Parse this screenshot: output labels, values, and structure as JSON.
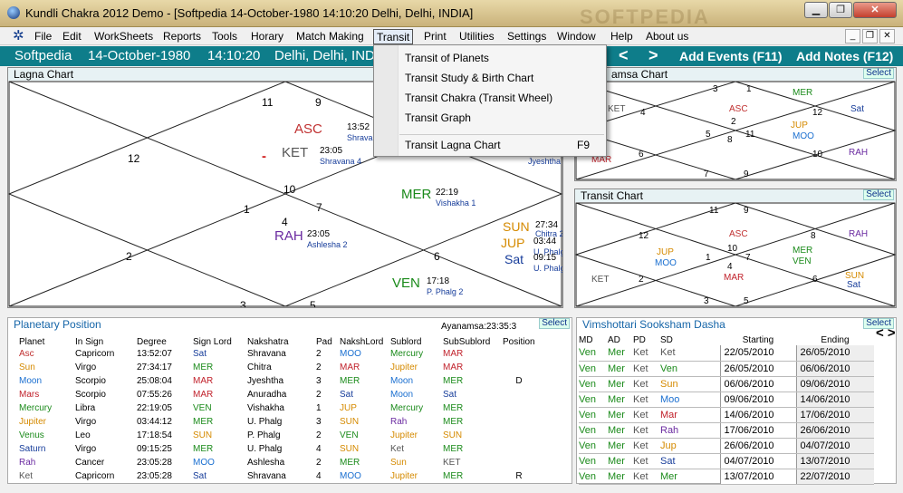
{
  "window": {
    "title": "Kundli Chakra 2012 Demo - [Softpedia     14-October-1980     14:10:20     Delhi, Delhi, INDIA]",
    "controls": [
      "▁",
      "❐",
      "✕"
    ],
    "watermark": "SOFTPEDIA"
  },
  "menu": {
    "items": [
      "File",
      "Edit",
      "WorkSheets",
      "Reports",
      "Tools",
      "Horary",
      "Match Making",
      "Transit",
      "Print",
      "Utilities",
      "Settings",
      "Window",
      "Help",
      "About us"
    ],
    "mdi_controls": [
      "_",
      "❐",
      "✕"
    ]
  },
  "info": {
    "name": "Softpedia",
    "date": "14-October-1980",
    "time": "14:10:20",
    "place": "Delhi, Delhi, INDIA",
    "prev": "<",
    "next": ">",
    "add_events": "Add Events (F11)",
    "add_notes": "Add Notes (F12)"
  },
  "dropdown": {
    "items": [
      "Transit of Planets",
      "Transit Study & Birth Chart",
      "Transit Chakra (Transit Wheel)",
      "Transit Graph",
      "Transit Lagna Chart"
    ],
    "shortcut": "F9"
  },
  "lagna": {
    "title": "Lagna Chart",
    "houses": [
      "11",
      "9",
      "12",
      "10",
      "1",
      "7",
      "4",
      "2",
      "6",
      "3",
      "5"
    ],
    "planets": [
      {
        "name": "ASC",
        "deg": "13:52",
        "nak": "Shrava"
      },
      {
        "name": "KET",
        "deg": "23:05",
        "nak": "Shravana 4"
      },
      {
        "name": "MER",
        "deg": "22:19",
        "nak": "Vishakha 1"
      },
      {
        "name": "RAH",
        "deg": "23:05",
        "nak": "Ashlesha 2"
      },
      {
        "name": "SUN",
        "deg": "27:34",
        "nak": "Chitra 2"
      },
      {
        "name": "JUP",
        "deg": "03:44",
        "nak": "U. Phalg"
      },
      {
        "name": "Sat",
        "deg": "09:15",
        "nak": "U. Phalg"
      },
      {
        "name": "VEN",
        "deg": "17:18",
        "nak": "P. Phalg 2"
      }
    ],
    "moon_nak": "Jyeshtha",
    "retro_mark": "-"
  },
  "navamsa": {
    "title": "amsa Chart",
    "select": "Select",
    "houses": [
      "3",
      "1",
      "4",
      "12",
      "5",
      "11",
      "2",
      "8",
      "6",
      "10",
      "7",
      "9"
    ],
    "planets": [
      "MER",
      "KET",
      "ASC",
      "Sat",
      "JUP",
      "MOO",
      "MAR",
      "RAH"
    ]
  },
  "transit": {
    "title": "Transit Chart",
    "select": "Select",
    "houses": [
      "11",
      "9",
      "12",
      "8",
      "10",
      "1",
      "7",
      "4",
      "2",
      "6",
      "3",
      "5"
    ],
    "planets": [
      "ASC",
      "RAH",
      "JUP",
      "MOO",
      "MER",
      "VEN",
      "MAR",
      "KET",
      "SUN",
      "Sat"
    ]
  },
  "planetary": {
    "title": "Planetary Position",
    "ayanamsa": "Ayanamsa:23:35:3",
    "select": "Select",
    "headers": [
      "Planet",
      "In Sign",
      "Degree",
      "Sign Lord",
      "Nakshatra",
      "Pad",
      "NakshLord",
      "Sublord",
      "SubSublord",
      "Position"
    ],
    "rows": [
      [
        "Asc",
        "Capricorn",
        "13:52:07",
        "Sat",
        "Shravana",
        "2",
        "MOO",
        "Mercury",
        "MAR",
        ""
      ],
      [
        "Sun",
        "Virgo",
        "27:34:17",
        "MER",
        "Chitra",
        "2",
        "MAR",
        "Jupiter",
        "MAR",
        ""
      ],
      [
        "Moon",
        "Scorpio",
        "25:08:04",
        "MAR",
        "Jyeshtha",
        "3",
        "MER",
        "Moon",
        "MER",
        "D"
      ],
      [
        "Mars",
        "Scorpio",
        "07:55:26",
        "MAR",
        "Anuradha",
        "2",
        "Sat",
        "Moon",
        "Sat",
        ""
      ],
      [
        "Mercury",
        "Libra",
        "22:19:05",
        "VEN",
        "Vishakha",
        "1",
        "JUP",
        "Mercury",
        "MER",
        ""
      ],
      [
        "Jupiter",
        "Virgo",
        "03:44:12",
        "MER",
        "U. Phalg",
        "3",
        "SUN",
        "Rah",
        "MER",
        ""
      ],
      [
        "Venus",
        "Leo",
        "17:18:54",
        "SUN",
        "P. Phalg",
        "2",
        "VEN",
        "Jupiter",
        "SUN",
        ""
      ],
      [
        "Saturn",
        "Virgo",
        "09:15:25",
        "MER",
        "U. Phalg",
        "4",
        "SUN",
        "Ket",
        "MER",
        ""
      ],
      [
        "Rah",
        "Cancer",
        "23:05:28",
        "MOO",
        "Ashlesha",
        "2",
        "MER",
        "Sun",
        "KET",
        ""
      ],
      [
        "Ket",
        "Capricorn",
        "23:05:28",
        "Sat",
        "Shravana",
        "4",
        "MOO",
        "Jupiter",
        "MER",
        "R"
      ]
    ]
  },
  "dasha": {
    "title": "Vimshottari Sooksham Dasha",
    "select": "Select",
    "headers": [
      "MD",
      "AD",
      "PD",
      "SD",
      "Starting",
      "Ending"
    ],
    "nav": "< >",
    "rows": [
      [
        "Ven",
        "Mer",
        "Ket",
        "Ket",
        "22/05/2010",
        "26/05/2010"
      ],
      [
        "Ven",
        "Mer",
        "Ket",
        "Ven",
        "26/05/2010",
        "06/06/2010"
      ],
      [
        "Ven",
        "Mer",
        "Ket",
        "Sun",
        "06/06/2010",
        "09/06/2010"
      ],
      [
        "Ven",
        "Mer",
        "Ket",
        "Moo",
        "09/06/2010",
        "14/06/2010"
      ],
      [
        "Ven",
        "Mer",
        "Ket",
        "Mar",
        "14/06/2010",
        "17/06/2010"
      ],
      [
        "Ven",
        "Mer",
        "Ket",
        "Rah",
        "17/06/2010",
        "26/06/2010"
      ],
      [
        "Ven",
        "Mer",
        "Ket",
        "Jup",
        "26/06/2010",
        "04/07/2010"
      ],
      [
        "Ven",
        "Mer",
        "Ket",
        "Sat",
        "04/07/2010",
        "13/07/2010"
      ],
      [
        "Ven",
        "Mer",
        "Ket",
        "Mer",
        "13/07/2010",
        "22/07/2010"
      ]
    ]
  },
  "colors": {
    "accent": "#0e7d8a",
    "ven": "#1a8a1a",
    "mer": "#1a8a1a",
    "ket": "#555555",
    "sun": "#d58a00",
    "moo": "#1a6fd0",
    "mar": "#c0202a",
    "rah": "#6a2aa0",
    "jup": "#d58a00",
    "sat": "#163c9a"
  }
}
